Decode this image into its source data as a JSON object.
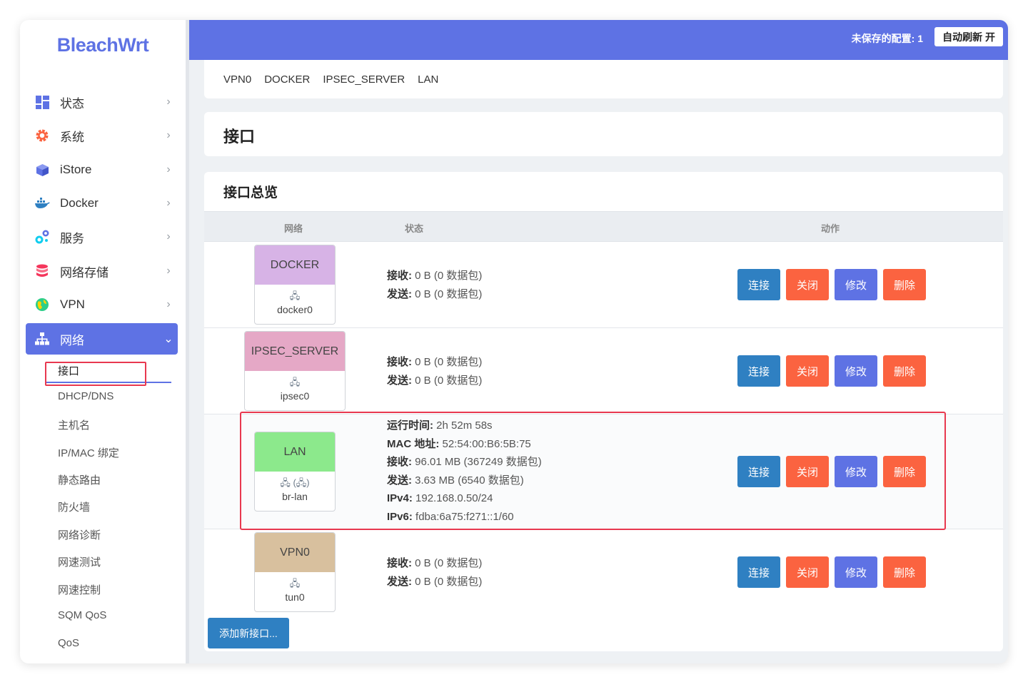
{
  "app": {
    "logo": "BleachWrt"
  },
  "sidebar": {
    "items": [
      {
        "label": "状态",
        "icon": "dashboard-icon",
        "color": "#5e72e4"
      },
      {
        "label": "系统",
        "icon": "gear-icon",
        "color": "#fb6340"
      },
      {
        "label": "iStore",
        "icon": "box-icon",
        "color": "#5e72e4"
      },
      {
        "label": "Docker",
        "icon": "docker-icon",
        "color": "#2f80c2"
      },
      {
        "label": "服务",
        "icon": "services-icon",
        "color": "#11cdef"
      },
      {
        "label": "网络存储",
        "icon": "database-icon",
        "color": "#f5365c"
      },
      {
        "label": "VPN",
        "icon": "globe-icon",
        "color": "#2dce89"
      },
      {
        "label": "网络",
        "icon": "network-icon",
        "color": "#ffffff"
      }
    ],
    "subitems": [
      "接口",
      "DHCP/DNS",
      "主机名",
      "IP/MAC 绑定",
      "静态路由",
      "防火墙",
      "网络诊断",
      "网速测试",
      "网速控制",
      "SQM QoS",
      "QoS"
    ]
  },
  "topbar": {
    "unsaved": "未保存的配置: 1",
    "auto_refresh": "自动刷新 开"
  },
  "tabs": [
    "VPN0",
    "DOCKER",
    "IPSEC_SERVER",
    "LAN"
  ],
  "page": {
    "title": "接口"
  },
  "overview": {
    "title": "接口总览",
    "headers": {
      "network": "网络",
      "status": "状态",
      "actions": "动作"
    },
    "buttons": {
      "connect": "连接",
      "close": "关闭",
      "edit": "修改",
      "delete": "删除"
    },
    "add_button": "添加新接口...",
    "rows": [
      {
        "name": "DOCKER",
        "color": "#d7b3e6",
        "device": "docker0",
        "device_icons": "🖧",
        "status": [
          {
            "k": "接收:",
            "v": " 0 B (0 数据包)"
          },
          {
            "k": "发送:",
            "v": " 0 B (0 数据包)"
          }
        ]
      },
      {
        "name": "IPSEC_SERVER",
        "color": "#e5a8c6",
        "device": "ipsec0",
        "device_icons": "🖧",
        "status": [
          {
            "k": "接收:",
            "v": " 0 B (0 数据包)"
          },
          {
            "k": "发送:",
            "v": " 0 B (0 数据包)"
          }
        ]
      },
      {
        "name": "LAN",
        "color": "#8ce98c",
        "device": "br-lan",
        "device_icons": "🖧 (🖧)",
        "status": [
          {
            "k": "运行时间:",
            "v": " 2h 52m 58s"
          },
          {
            "k": "MAC 地址:",
            "v": " 52:54:00:B6:5B:75"
          },
          {
            "k": "接收:",
            "v": " 96.01 MB (367249 数据包)"
          },
          {
            "k": "发送:",
            "v": " 3.63 MB (6540 数据包)"
          },
          {
            "k": "IPv4:",
            "v": " 192.168.0.50/24"
          },
          {
            "k": "IPv6:",
            "v": " fdba:6a75:f271::1/60"
          }
        ]
      },
      {
        "name": "VPN0",
        "color": "#d8c09e",
        "device": "tun0",
        "device_icons": "🖧",
        "status": [
          {
            "k": "接收:",
            "v": " 0 B (0 数据包)"
          },
          {
            "k": "发送:",
            "v": " 0 B (0 数据包)"
          }
        ]
      }
    ]
  }
}
